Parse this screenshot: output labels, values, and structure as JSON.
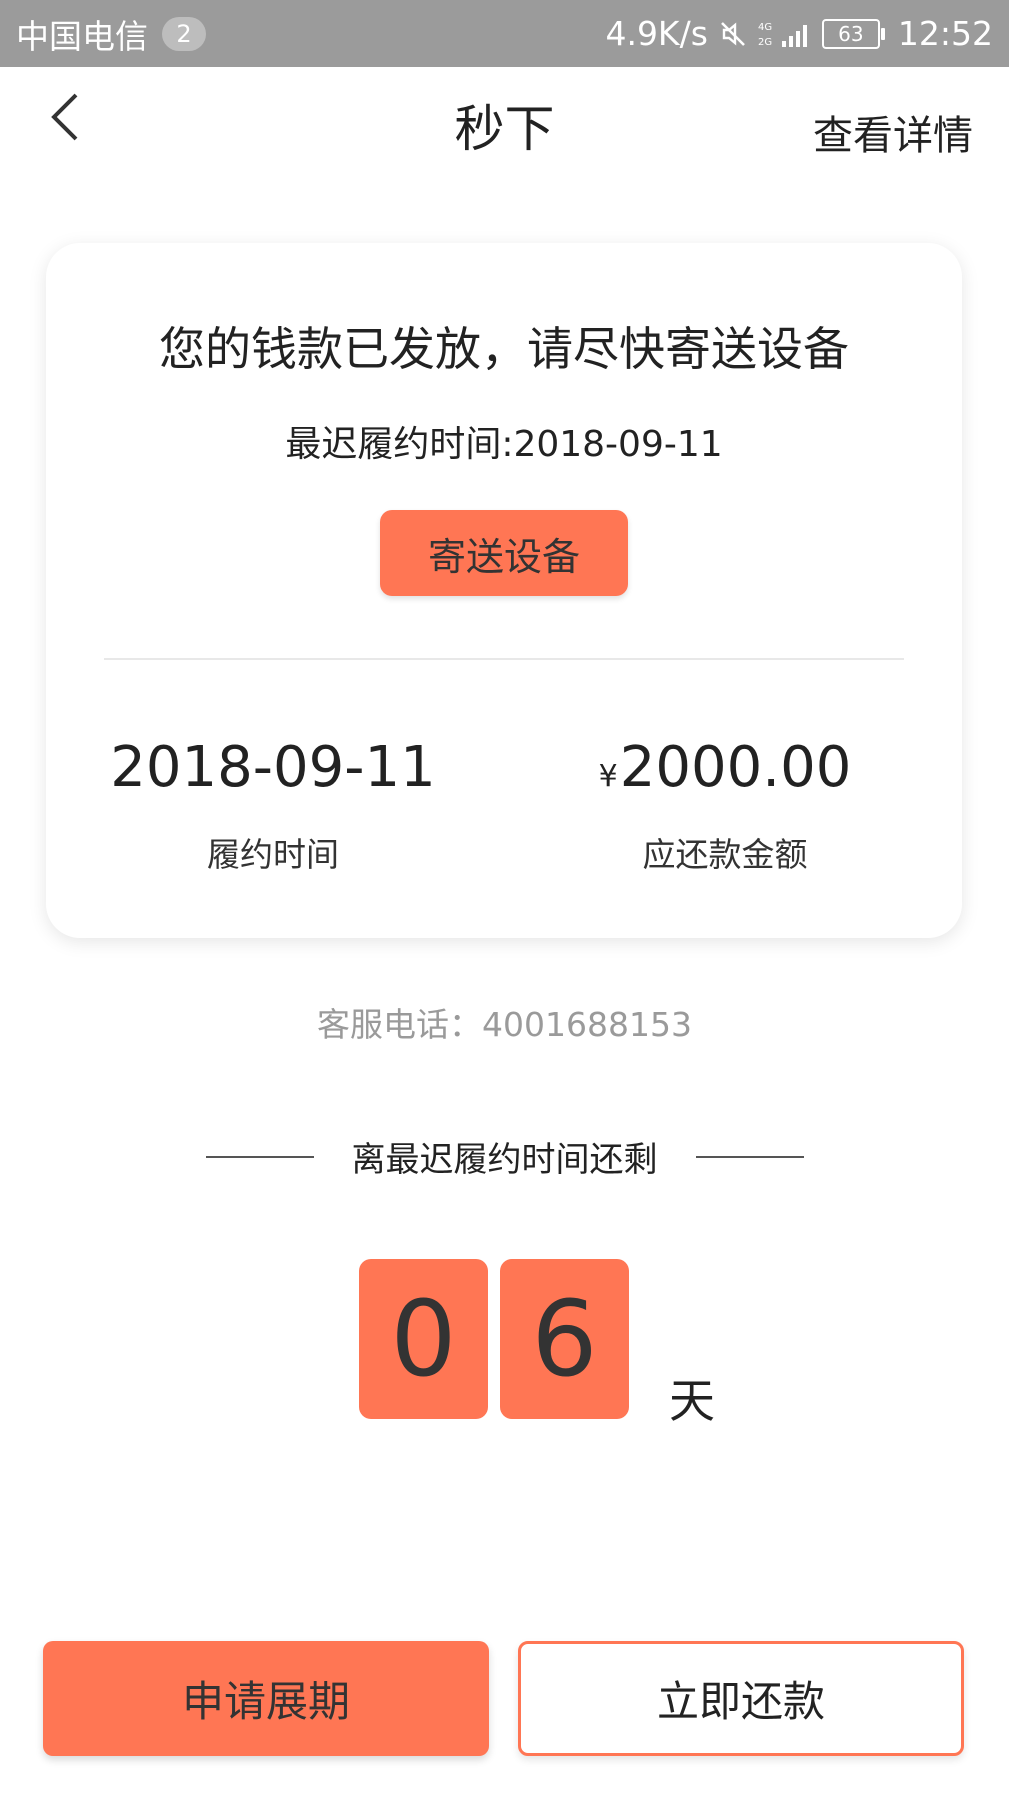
{
  "status_bar": {
    "carrier": "中国电信",
    "sim_badge": "2",
    "net_speed": "4.9K/s",
    "network": "4G 2G",
    "battery": "63",
    "time": "12:52"
  },
  "header": {
    "title": "秒下",
    "detail_link": "查看详情"
  },
  "card": {
    "title": "您的钱款已发放，请尽快寄送设备",
    "deadline": "最迟履约时间:2018-09-11",
    "send_button": "寄送设备",
    "date_value": "2018-09-11",
    "date_label": "履约时间",
    "amount_currency": "¥",
    "amount_value": "2000.00",
    "amount_label": "应还款金额"
  },
  "service_phone": "客服电话：4001688153",
  "countdown": {
    "label": "离最迟履约时间还剩",
    "digit1": "0",
    "digit2": "6",
    "unit": "天"
  },
  "buttons": {
    "extend": "申请展期",
    "repay": "立即还款"
  },
  "colors": {
    "accent": "#ff7654",
    "statusbar": "#9b9b9b"
  }
}
